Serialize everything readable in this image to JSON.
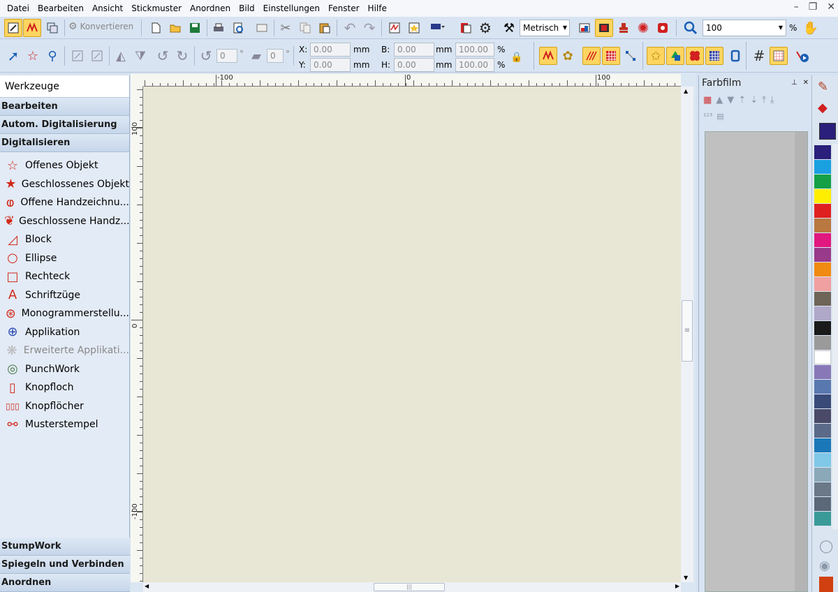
{
  "menu": [
    "Datei",
    "Bearbeiten",
    "Ansicht",
    "Stickmuster",
    "Anordnen",
    "Bild",
    "Einstellungen",
    "Fenster",
    "Hilfe"
  ],
  "toolbar": {
    "konvertieren": "Konvertieren",
    "units": "Metrisch",
    "zoom_value": "100",
    "zoom_unit": "%",
    "rotate_value": "0",
    "slant_value": "0",
    "deg": "°"
  },
  "coords": {
    "x_label": "X:",
    "y_label": "Y:",
    "x_value": "0.00",
    "y_value": "0.00",
    "b_label": "B:",
    "h_label": "H:",
    "b_value": "0.00",
    "h_value": "0.00",
    "unit": "mm",
    "pct_b": "100.00",
    "pct_h": "100.00",
    "pct": "%"
  },
  "left_panel": {
    "title": "Werkzeuge",
    "sections_top": [
      "Bearbeiten",
      "Autom. Digitalisierung",
      "Digitalisieren"
    ],
    "tools": [
      {
        "label": "Offenes Objekt",
        "icon": "open-object-icon",
        "enabled": true
      },
      {
        "label": "Geschlossenes Objekt",
        "icon": "closed-object-icon",
        "enabled": true
      },
      {
        "label": "Offene Handzeichnu...",
        "icon": "open-freehand-icon",
        "enabled": true
      },
      {
        "label": "Geschlossene Handz...",
        "icon": "closed-freehand-icon",
        "enabled": true
      },
      {
        "label": "Block",
        "icon": "block-icon",
        "enabled": true
      },
      {
        "label": "Ellipse",
        "icon": "ellipse-icon",
        "enabled": true
      },
      {
        "label": "Rechteck",
        "icon": "rectangle-icon",
        "enabled": true
      },
      {
        "label": "Schriftzüge",
        "icon": "lettering-icon",
        "enabled": true
      },
      {
        "label": "Monogrammerstellu...",
        "icon": "monogram-icon",
        "enabled": true
      },
      {
        "label": "Applikation",
        "icon": "applique-icon",
        "enabled": true
      },
      {
        "label": "Erweiterte Applikati...",
        "icon": "advanced-applique-icon",
        "enabled": false
      },
      {
        "label": "PunchWork",
        "icon": "punchwork-icon",
        "enabled": true
      },
      {
        "label": "Knopfloch",
        "icon": "buttonhole-icon",
        "enabled": true
      },
      {
        "label": "Knopflöcher",
        "icon": "buttonholes-icon",
        "enabled": true
      },
      {
        "label": "Musterstempel",
        "icon": "pattern-stamp-icon",
        "enabled": true
      }
    ],
    "sections_bottom": [
      "StumpWork",
      "Spiegeln und Verbinden",
      "Anordnen"
    ]
  },
  "ruler": {
    "h_labels": [
      "-100",
      "0",
      "100"
    ],
    "v_labels": [
      "100",
      "0",
      "-100"
    ]
  },
  "farbfilm": {
    "title": "Farbfilm",
    "pin": "📌",
    "close": "✕"
  },
  "palette": {
    "current": "#2a1f7a",
    "colors": [
      "#2a1f7a",
      "#1aa0e0",
      "#15a045",
      "#ffee00",
      "#e02020",
      "#b87840",
      "#e01880",
      "#9a3a8a",
      "#f08a10",
      "#f0a0a0",
      "#6e6458",
      "#b0a8c8",
      "#1a1a1a",
      "#9a9a9a",
      "#ffffff",
      "#8878b8",
      "#5a78b0",
      "#3a4a78",
      "#4a4a68",
      "#5a6a88",
      "#1a78b8",
      "#80c8e8",
      "#8aa8b8",
      "#6a7888",
      "#5a6878",
      "#3a9a98"
    ]
  }
}
